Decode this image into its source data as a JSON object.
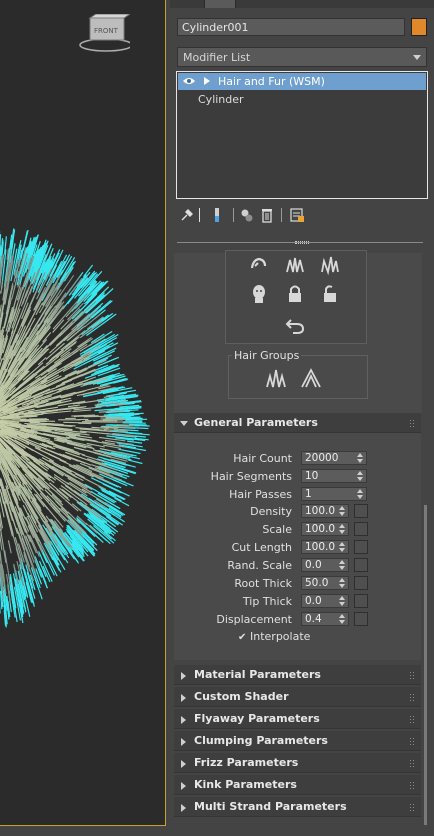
{
  "viewport": {
    "viewcube_label": "FRONT",
    "accent_border_color": "#c9a227",
    "fur_highlight_color": "#38e8f0",
    "fur_color": "#aabba2"
  },
  "command_panel": {
    "object_name": "Cylinder001",
    "object_color": "#e0882a",
    "modifier_list_label": "Modifier List",
    "stack": [
      {
        "label": "Hair and Fur (WSM)",
        "selected": true,
        "icons": [
          "eye-icon",
          "expand-arrow-icon"
        ]
      },
      {
        "label": "Cylinder",
        "selected": false
      }
    ],
    "stack_toolbar_icons": [
      "pin-stack-icon",
      "show-end-result-icon",
      "make-unique-icon",
      "remove-modifier-icon",
      "configure-modifier-sets-icon"
    ],
    "selection_tools_icons": [
      "grow-hair-icon",
      "grass-select-icon",
      "grass-select-2-icon",
      "hide-icon",
      "lock-icon",
      "unlock-icon",
      "undo-icon"
    ],
    "hair_groups": {
      "label": "Hair Groups",
      "icons": [
        "split-groups-icon",
        "merge-groups-icon"
      ]
    }
  },
  "general_parameters": {
    "title": "General Parameters",
    "params": [
      {
        "label": "Hair Count",
        "value": "20000",
        "has_map": false
      },
      {
        "label": "Hair Segments",
        "value": "10",
        "has_map": false
      },
      {
        "label": "Hair Passes",
        "value": "1",
        "has_map": false
      },
      {
        "label": "Density",
        "value": "100.0",
        "has_map": true
      },
      {
        "label": "Scale",
        "value": "100.0",
        "has_map": true
      },
      {
        "label": "Cut Length",
        "value": "100.0",
        "has_map": true
      },
      {
        "label": "Rand. Scale",
        "value": "0.0",
        "has_map": true
      },
      {
        "label": "Root Thick",
        "value": "50.0",
        "has_map": true
      },
      {
        "label": "Tip Thick",
        "value": "0.0",
        "has_map": true
      },
      {
        "label": "Displacement",
        "value": "0.4",
        "has_map": true
      }
    ],
    "interpolate": {
      "label": "Interpolate",
      "checked": true,
      "mark": "✔"
    }
  },
  "collapsed_rollouts": [
    "Material Parameters",
    "Custom Shader",
    "Flyaway Parameters",
    "Clumping Parameters",
    "Frizz Parameters",
    "Kink Parameters",
    "Multi Strand Parameters"
  ]
}
